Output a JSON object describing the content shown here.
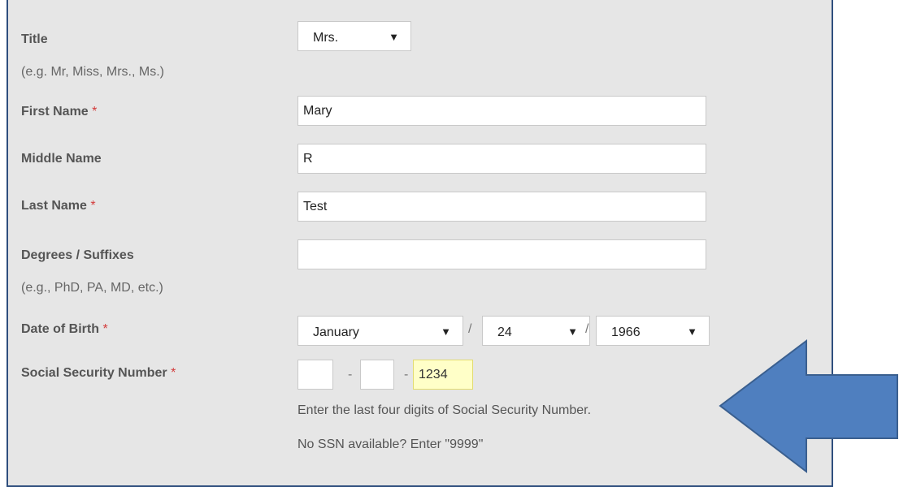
{
  "form": {
    "title": {
      "label": "Title",
      "hint": "(e.g. Mr, Miss, Mrs., Ms.)",
      "value": "Mrs."
    },
    "first_name": {
      "label": "First Name",
      "required": "*",
      "value": "Mary"
    },
    "middle_name": {
      "label": "Middle Name",
      "value": "R"
    },
    "last_name": {
      "label": "Last Name",
      "required": "*",
      "value": "Test"
    },
    "degrees": {
      "label": "Degrees / Suffixes",
      "hint": "(e.g., PhD, PA, MD, etc.)",
      "value": ""
    },
    "dob": {
      "label": "Date of Birth",
      "required": "*",
      "month": "January",
      "day": "24",
      "year": "1966",
      "separator": "/"
    },
    "ssn": {
      "label": "Social Security Number",
      "required": "*",
      "part1": "",
      "part2": "",
      "part3": "1234",
      "separator": "-",
      "note1": "Enter the last four digits of Social Security Number.",
      "note2": "No SSN available? Enter \"9999\""
    }
  },
  "icons": {
    "dropdown": "caret-down-icon",
    "annotation": "left-arrow-callout"
  },
  "colors": {
    "panel_bg": "#e6e6e6",
    "panel_border": "#2f4f7e",
    "required": "#d33b3b",
    "highlight": "#ffffc8",
    "arrow_fill": "#4f7fbf",
    "arrow_stroke": "#3a5f8f"
  }
}
